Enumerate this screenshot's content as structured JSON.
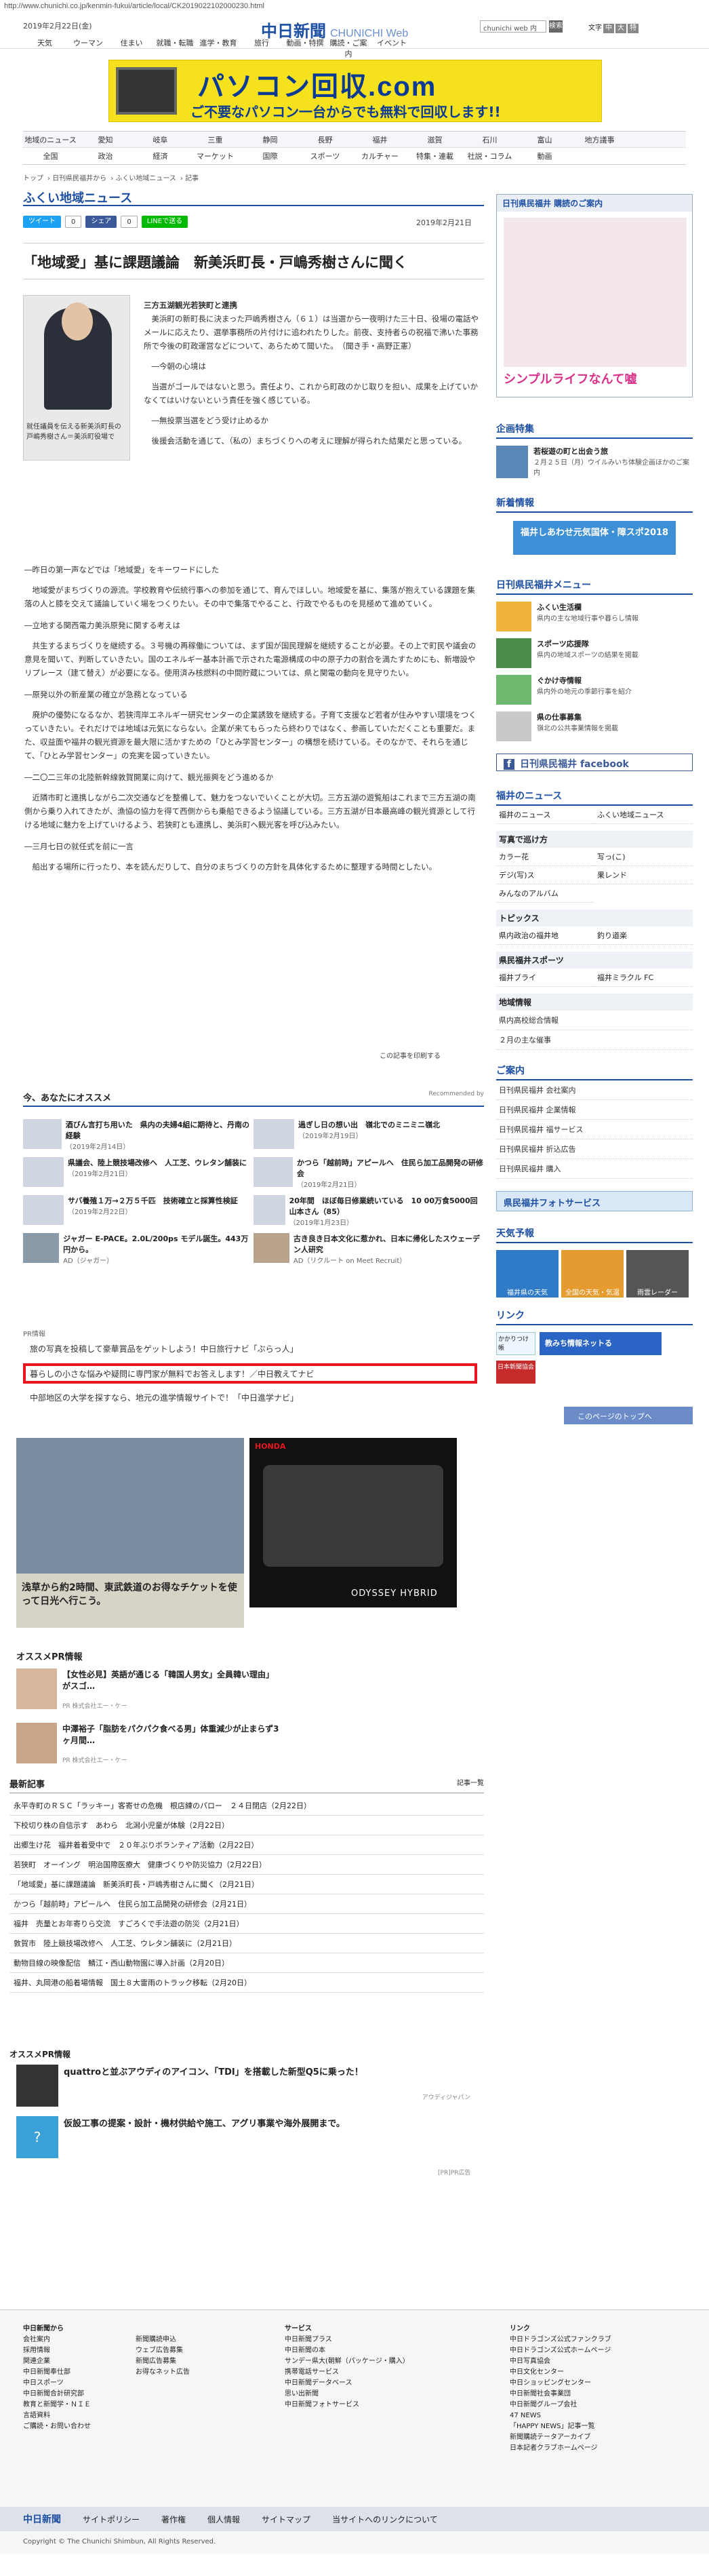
{
  "url": "http://www.chunichi.co.jp/kenmin-fukui/article/local/CK2019022102000230.html",
  "header": {
    "date": "2019年2月22日(金)",
    "logo": "中日新聞",
    "logo_sub": "CHUNICHI Web",
    "search_placeholder": "chunichi web 内",
    "search_btn": "検索",
    "font_label": "文字",
    "font_buttons": [
      "中",
      "大",
      "特"
    ],
    "topnav": [
      "天気",
      "ウーマン",
      "住まい",
      "就職・転職",
      "進学・教育",
      "旅行",
      "動画・特撰",
      "購読・ご案内",
      "イベント"
    ]
  },
  "banner": {
    "title": "パソコン回収.com",
    "sub": "ご不要なパソコン一台からでも無料で回収します!!"
  },
  "catnav": {
    "row1": [
      "地域のニュース",
      "愛知",
      "岐阜",
      "三重",
      "静岡",
      "長野",
      "福井",
      "滋賀",
      "石川",
      "富山",
      "地方議事"
    ],
    "row2": [
      "全国",
      "政治",
      "経済",
      "マーケット",
      "国際",
      "スポーツ",
      "カルチャー",
      "特集・連載",
      "社説・コラム",
      "動画"
    ]
  },
  "breadcrumb": [
    "トップ",
    "日刊県民福井から",
    "ふくい地域ニュース",
    "記事"
  ],
  "section_title": "ふくい地域ニュース",
  "social": {
    "tweet": "ツイート",
    "fb_count": "0",
    "share": "シェア",
    "share_count": "0",
    "line": "LINEで送る"
  },
  "article": {
    "date": "2019年2月21日",
    "headline": "「地域愛」基に課題議論　新美浜町長・戸嶋秀樹さんに聞く",
    "photo_caption": "就任議員を伝える新美浜町長の戸嶋秀樹さん＝美浜町役場で",
    "byline": "三方五湖観光若狭町と連携",
    "paragraphs": [
      "　美浜町の新町長に決まった戸嶋秀樹さん（６１）は当選から一夜明けた三十日、役場の電話やメールに応えたり、選挙事務所の片付けに追われたりした。前夜、支持者らの祝福で沸いた事務所で今後の町政運営などについて、あらためて聞いた。　（聞き手・高野正憲）",
      "　―今朝の心境は",
      "　当選がゴールではないと思う。責任より、これから町政のかじ取りを担い、成果を上げていかなくてはいけないという責任を強く感じている。",
      "　―無投票当選をどう受け止めるか",
      "　後援会活動を通じて、（私の）まちづくりへの考えに理解が得られた結果だと思っている。",
      "―昨日の第一声などでは「地域愛」をキーワードにした",
      "　地域愛がまちづくりの源流。学校教育や伝統行事への参加を通じて、育んでほしい。地域愛を基に、集落が抱えている課題を集落の人と膝を交えて議論していく場をつくりたい。その中で集落でやること、行政でやるものを見極めて進めていく。",
      "―立地する関西電力美浜原発に関する考えは",
      "　共生するまちづくりを継続する。３号機の再稼働については、まず国が国民理解を継続することが必要。その上で町民や議会の意見を聞いて、判断していきたい。国のエネルギー基本計画で示された電源構成の中の原子力の割合を満たすためにも、新増設やリプレース（建て替え）が必要になる。使用済み核燃料の中間貯蔵については、県と関電の動向を見守りたい。",
      "―原発以外の新産業の確立が急務となっている",
      "　廃炉の優勢になるなか、若狭湾岸エネルギー研究センターの企業誘致を継続する。子育て支援など若者が住みやすい環境をつくっていきたい。それだけでは地域は元気にならない。企業が来てもらったら終わりではなく、参画していただくことも重要だ。また、収益面や福井の観光資源を最大限に活かすための「ひとみ学習センター」の構想を続けている。そのなかで、それらを通じて、「ひとみ学習センター」の充実を図っていきたい。",
      "―二〇二三年の北陸新幹線敦賀開業に向けて、観光振興をどう進めるか",
      "　近隣市町と連携しながら二次交通などを整備して、魅力をつないでいくことが大切。三方五湖の遊覧船はこれまで三方五湖の南側から乗り入れてきたが、漁協の協力を得て西側からも乗船できるよう協議している。三方五湖が日本最高峰の観光資源として行ける地域に魅力を上げていけるよう、若狭町とも連携し、美浜町へ観光客を呼び込みたい。",
      "―三月七日の就任式を前に一言",
      "　船出する場所に行ったり、本を読んだりして、自分のまちづくりの方針を具体化するために整理する時間としたい。"
    ],
    "report": "この記事を印刷する"
  },
  "recommend": {
    "title": "今、あなたにオススメ",
    "powered": "Recommended by",
    "items": [
      {
        "t": "酒びん言打ち用いた　県内の夫婦4組に期待と、丹南の経験",
        "d": "（2019年2月14日）"
      },
      {
        "t": "過ぎし日の想い出　嶺北でのミニミニ嶺北",
        "d": "（2019年2月19日）"
      },
      {
        "t": "県議会、陸上競技場改修へ　人工芝、ウレタン舗装に",
        "d": "（2019年2月21日）"
      },
      {
        "t": "かつら「越前時」アピールへ　住民ら加工品開発の研修会",
        "d": "（2019年2月21日）"
      },
      {
        "t": "サバ養殖１万→２万５千匹　技術確立と採算性検証",
        "d": "（2019年2月22日）"
      },
      {
        "t": "20年間　ほぼ毎日修業続いている　10 00万食5000回　山本さん（85）",
        "d": "（2019年1月23日）"
      },
      {
        "t": "ジャガー E-PACE。2.0L/200ps モデル誕生。443万円から。",
        "d": "AD（ジャガー）"
      },
      {
        "t": "古き良き日本文化に惹かれ、日本に帰化したスウェーデン人研究",
        "d": "AD（リクルート on Meet Recruit）"
      }
    ]
  },
  "pr_label": "PR情報",
  "pr_links": [
    "旅の写真を投稿して豪華賞品をゲットしよう！中日旅行ナビ「ぶらっ人」",
    "暮らしの小さな悩みや疑問に専門家が無料でお答えします！／中日教えてナビ",
    "中部地区の大学を探すなら、地元の進学情報サイトで！「中日進学ナビ」"
  ],
  "ads": {
    "left_text": "浅草から約2時間、東武鉄道のお得なチケットを使って日光へ行こう。",
    "right_brand": "HONDA",
    "right_text": "ODYSSEY HYBRID"
  },
  "osusume_pr": {
    "title": "オススメPR情報",
    "items": [
      {
        "t": "【女性必見】英語が通じる「韓国人男女」全員韓い理由」がスゴ…",
        "s": "PR 株式会社エー・ケー"
      },
      {
        "t": "中澤裕子「脂肪をパクパク食べる男」体重減少が止まらず3ヶ月間…",
        "s": "PR 株式会社エー・ケー"
      }
    ]
  },
  "latest": {
    "title": "最新記事",
    "more": "記事一覧",
    "items": [
      "永平寺町のＲＳＣ「ラッキー」客寄せの危機　根店練のパロー　２４日閉店（2月22日）",
      "下校切り株の自信示す　あわら　北潟小児童が体験（2月22日）",
      "出郷生け花　福井着着受中で　２０年ぶりボランティア活動（2月22日）",
      "若狭町　オーイング　明治国際医療大　健康づくりや防災協力（2月22日）",
      "「地域愛」基に課題議論　新美浜町長・戸嶋秀樹さんに聞く（2月21日）",
      "かつら「越前時」アピールへ　住民ら加工品開発の研修会（2月21日）",
      "福井　売量とお年寄りら交流　すごろくで手法遊の防災（2月21日）",
      "敦賀市　陸上競技場改修へ　人工芝、ウレタン舗装に（2月21日）",
      "動物目線の映像配信　鯖江・西山動物園に導入計画（2月20日）",
      "福井、丸岡港の船着場情報　国土８大雷雨のトラック移転（2月20日）"
    ]
  },
  "osusume_pr2": {
    "title": "オススメPR情報",
    "items": [
      {
        "t": "quattroと並ぶアウディのアイコン、「TDI」を搭載した新型Q5に乗った！",
        "s": "アウディジャパン"
      },
      {
        "t": "仮設工事の提案・設計・機材供給や施工、アグリ事業や海外展開まで。",
        "s": ""
      }
    ],
    "footnote": "[PR]PR広告"
  },
  "sidebar": {
    "kenmin_title": "日刊県民福井 購読のご案内",
    "kenmin_sub": "シンプルライフなんて嘘",
    "kikaku_title": "企画特集",
    "kikaku": [
      {
        "t": "若桜遊の町と出会う旅",
        "s": "２月２５日（月）ウイルみいち体験企画ほかのご案内"
      }
    ],
    "shinki_title": "新着情報",
    "shinki_banner": "福井しあわせ元気国体・障スポ2018",
    "menu_title": "日刊県民福井メニュー",
    "menu": [
      {
        "t": "ふくい生活欄",
        "s": "県内の主な地域行事や暮らし情報"
      },
      {
        "t": "スポーツ応援隊",
        "s": "県内の地域スポーツの結果を掲載"
      },
      {
        "t": "ぐかけ寺情報",
        "s": "県内外の地元の季節行事を紹介"
      },
      {
        "t": "県の仕事募集",
        "s": "嶺北の公共事業情報を掲載"
      }
    ],
    "fb_label": "日刊県民福井 facebook",
    "fukui_title": "福井のニュース",
    "fukui": [
      "福井のニュース",
      "ふくい地域ニュース"
    ],
    "shashin_title": "写真で巡け方",
    "shashin": [
      "カラー花",
      "写っ(こ)",
      "デジ(写)ス",
      "果レンド",
      "みんなのアルバム"
    ],
    "topics_title": "トピックス",
    "topics": [
      "県内政治の福井地",
      "釣り道楽"
    ],
    "sports_title": "県民福井スポーツ",
    "sports": [
      "福井ブライ",
      "福井ミラクル FC"
    ],
    "chiiki_title": "地域情報",
    "chiiki": [
      "県内高校総合情報",
      "２月の主な催事"
    ],
    "annai_title": "ご案内",
    "annai": [
      "日刊県民福井 会社案内",
      "日刊県民福井 企業情報",
      "日刊県民福井 福サービス",
      "日刊県民福井 折込広告",
      "日刊県民福井 購入"
    ],
    "photo_service": "県民福井フォトサービス",
    "weather_title": "天気予報",
    "weather": [
      "福井県の天気",
      "全国の天気・気温",
      "雨雲レーダー"
    ],
    "link_title": "リンク",
    "links": [
      "かかりつけ帳",
      "教みち情報ネットる",
      "日本新聞協会"
    ],
    "page_top": "このページのトップへ"
  },
  "footer": {
    "col1": [
      "中日新聞から",
      "会社案内",
      "採用情報",
      "関連企業",
      "中日新聞奉仕部",
      "中日スポーツ",
      "中日新聞合計研究部",
      "教育と新聞学・ＮＩＥ",
      "言語資料",
      "ご購読・お問い合わせ"
    ],
    "col2": [
      "新聞購読申込",
      "ウェブ広告募集",
      "新聞広告募集",
      "お得なネット広告"
    ],
    "col3": [
      "サービス",
      "中日新聞プラス",
      "中日新聞の本",
      "サンデー県大(朝鮮（パッケージ・購入）",
      "携帯電話サービス",
      "中日新聞データベース",
      "思い出新聞",
      "中日新聞フォトサービス"
    ],
    "col4": [
      "リンク",
      "中日ドラゴンズ公式ファンクラブ",
      "中日ドラゴンズ公式ホームページ",
      "中日写真協会",
      "中日文化センター",
      "中日ショッピングセンター",
      "中日新聞社会事業団",
      "中日新聞グループ会社",
      "47 NEWS",
      "「HAPPY NEWS」記事一覧",
      "新聞購読テータアーカイブ",
      "日本記者クラブホームページ"
    ],
    "bottom": [
      "中日新聞",
      "サイトポリシー",
      "著作権",
      "個人情報",
      "サイトマップ",
      "当サイトへのリンクについて"
    ],
    "copyright": "Copyright © The Chunichi Shimbun, All Rights Reserved."
  }
}
